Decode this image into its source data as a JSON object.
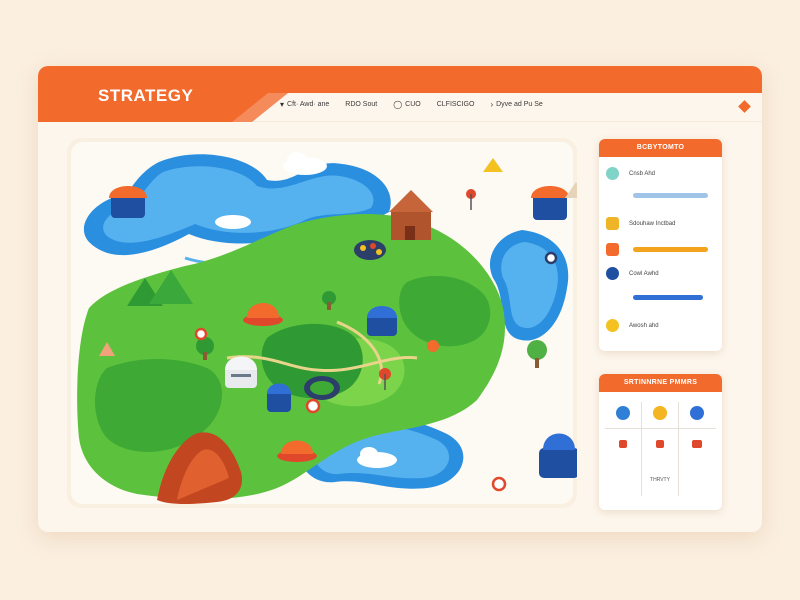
{
  "app": {
    "title": "STRATEGY"
  },
  "nav": [
    {
      "icon": "▾",
      "label": "Cft· Awd· ane"
    },
    {
      "icon": "",
      "label": "RDO Sout"
    },
    {
      "icon": "◯",
      "label": "CUO"
    },
    {
      "icon": "",
      "label": "CLFISCIGO"
    },
    {
      "icon": "›",
      "label": "Dyve ad Pu Se"
    }
  ],
  "status_panel": {
    "title": "BCBYTOMTO",
    "rows": [
      {
        "label": "Cnsb Ahd",
        "color": "#7fd3c7",
        "bar": "#9fc4e8",
        "bar_level": 0.0
      },
      {
        "label": "",
        "color": "#f3c221",
        "bar": "#9fc4e8",
        "bar_level": 1.0
      },
      {
        "label": "Sdouhaw Inctbad",
        "color": "#f0b429",
        "bar": "#9fc4e8",
        "bar_level": 0.0
      },
      {
        "label": "",
        "color": "#f26a2c",
        "bar": "#f3a31c",
        "bar_level": 1.0
      },
      {
        "label": "Cowl Awhd",
        "color": "#1f4fa0",
        "bar": "#9fc4e8",
        "bar_level": 0.0
      },
      {
        "label": "",
        "color": "#ffffff",
        "bar": "#2f6fd6",
        "bar_level": 0.9
      },
      {
        "label": "Awosh ahd",
        "color": "#f3c221",
        "bar": "#9fc4e8",
        "bar_level": 0.0
      }
    ]
  },
  "units_panel": {
    "title": "SRTINNRNE PMMRS",
    "cells": [
      {
        "color": "#2f7fd6",
        "label": ""
      },
      {
        "color": "#f3b521",
        "label": ""
      },
      {
        "color": "#2f6fd6",
        "label": ""
      },
      {
        "color": "#e0482c",
        "label": ""
      },
      {
        "color": "#e0482c",
        "label": ""
      },
      {
        "color": "#e0482c",
        "label": ""
      },
      {
        "color": "#ffffff",
        "label": ""
      },
      {
        "color": "#ffffff",
        "label": "THRVTY"
      },
      {
        "color": "#ffffff",
        "label": ""
      }
    ]
  },
  "map": {
    "icons": [
      "lake",
      "forest",
      "mountain",
      "tower",
      "castle",
      "village",
      "marker",
      "cloud"
    ]
  }
}
